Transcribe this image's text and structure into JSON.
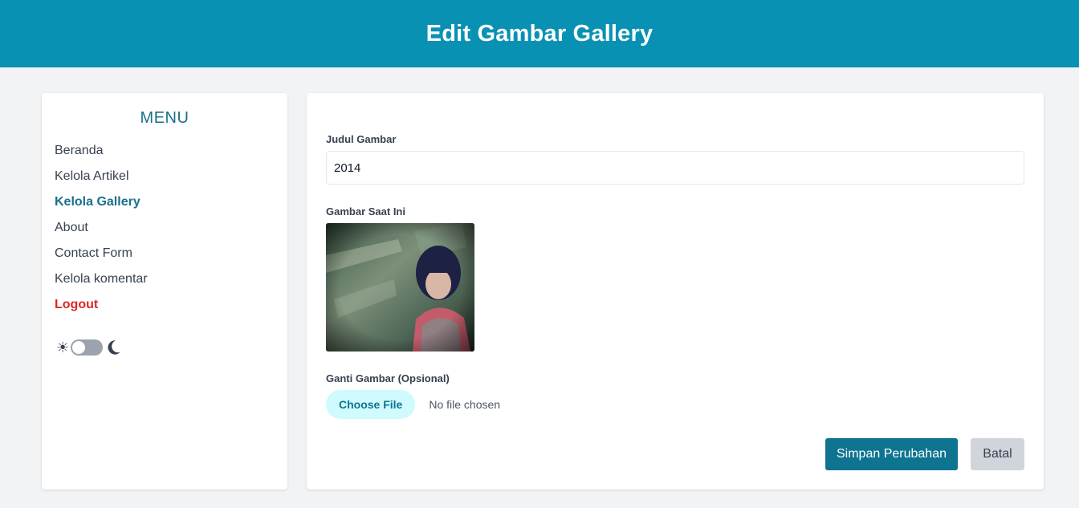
{
  "header": {
    "title": "Edit Gambar Gallery"
  },
  "sidebar": {
    "heading": "MENU",
    "items": [
      {
        "label": "Beranda",
        "state": "normal"
      },
      {
        "label": "Kelola Artikel",
        "state": "normal"
      },
      {
        "label": "Kelola Gallery",
        "state": "active"
      },
      {
        "label": "About",
        "state": "normal"
      },
      {
        "label": "Contact Form",
        "state": "normal"
      },
      {
        "label": "Kelola komentar",
        "state": "normal"
      },
      {
        "label": "Logout",
        "state": "logout"
      }
    ],
    "theme_toggle": {
      "light_icon": "sun-icon",
      "dark_icon": "moon-icon",
      "dark_mode": false
    }
  },
  "form": {
    "title_label": "Judul Gambar",
    "title_value": "2014",
    "current_image_label": "Gambar Saat Ini",
    "replace_label": "Ganti Gambar (Opsional)",
    "choose_file_label": "Choose File",
    "no_file_text": "No file chosen",
    "save_label": "Simpan Perubahan",
    "cancel_label": "Batal"
  },
  "colors": {
    "header_bg": "#0891b2",
    "accent": "#1a6f8a",
    "save_button": "#0e7490",
    "logout": "#dc2626",
    "cancel_button": "#d1d5db"
  }
}
